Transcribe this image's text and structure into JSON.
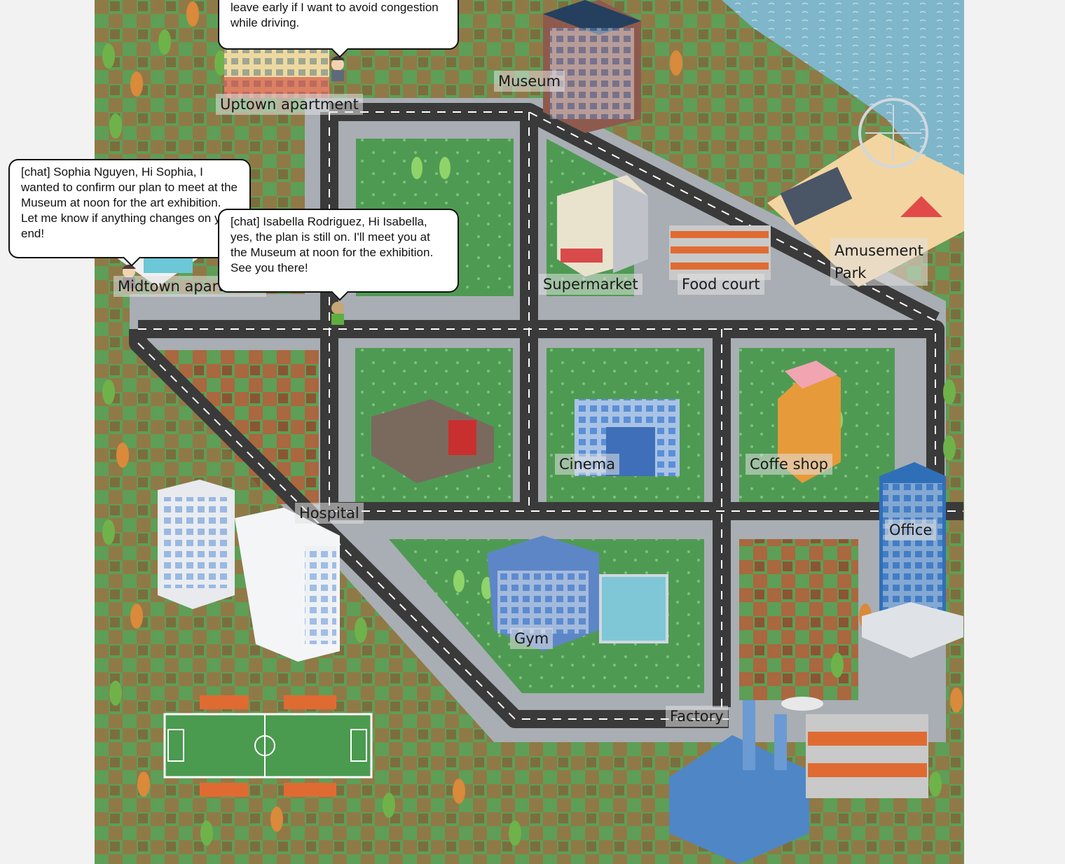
{
  "locations": {
    "uptown_apartment": "Uptown apartment",
    "museum": "Museum",
    "amusement_park": "Amusement\nPark",
    "midtown_apartment": "Midtown apartment",
    "supermarket": "Supermarket",
    "food_court": "Food court",
    "hospital": "Hospital",
    "cinema": "Cinema",
    "coffee_shop": "Coffe shop",
    "office": "Office",
    "gym": "Gym",
    "factory": "Factory"
  },
  "chat": {
    "top": "hours when traveling. I should aim to leave early if I want to avoid congestion while driving.",
    "sophia": "[chat] Sophia Nguyen, Hi Sophia, I wanted to confirm our plan to meet at the Museum at noon for the art exhibition. Let me know if anything changes on your end!",
    "isabella": "[chat] Isabella Rodriguez, Hi Isabella, yes, the plan is still on. I'll meet you at the Museum at noon for the exhibition. See you there!"
  },
  "colors": {
    "grass": "#5e9e57",
    "dirt": "#a9683f",
    "road": "#3a3a3a",
    "sidewalk": "#a8aeb3",
    "water": "#7fb6c9",
    "block_grass": "#4f9a53"
  },
  "icons": [
    "agent-sprite",
    "building",
    "tree",
    "ferris-wheel",
    "soccer-field",
    "factory-chimney"
  ]
}
